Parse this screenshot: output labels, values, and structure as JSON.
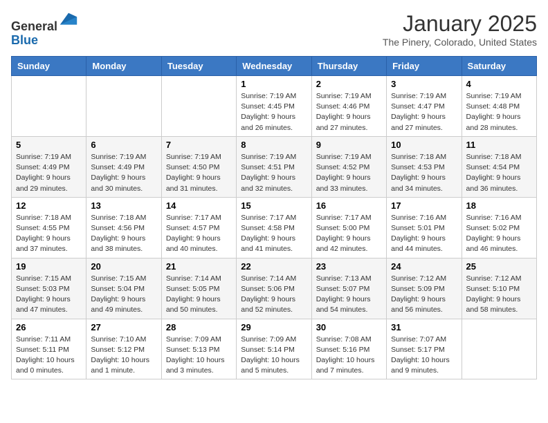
{
  "header": {
    "logo_line1": "General",
    "logo_line2": "Blue",
    "month": "January 2025",
    "location": "The Pinery, Colorado, United States"
  },
  "weekdays": [
    "Sunday",
    "Monday",
    "Tuesday",
    "Wednesday",
    "Thursday",
    "Friday",
    "Saturday"
  ],
  "weeks": [
    [
      {
        "day": "",
        "info": ""
      },
      {
        "day": "",
        "info": ""
      },
      {
        "day": "",
        "info": ""
      },
      {
        "day": "1",
        "info": "Sunrise: 7:19 AM\nSunset: 4:45 PM\nDaylight: 9 hours and 26 minutes."
      },
      {
        "day": "2",
        "info": "Sunrise: 7:19 AM\nSunset: 4:46 PM\nDaylight: 9 hours and 27 minutes."
      },
      {
        "day": "3",
        "info": "Sunrise: 7:19 AM\nSunset: 4:47 PM\nDaylight: 9 hours and 27 minutes."
      },
      {
        "day": "4",
        "info": "Sunrise: 7:19 AM\nSunset: 4:48 PM\nDaylight: 9 hours and 28 minutes."
      }
    ],
    [
      {
        "day": "5",
        "info": "Sunrise: 7:19 AM\nSunset: 4:49 PM\nDaylight: 9 hours and 29 minutes."
      },
      {
        "day": "6",
        "info": "Sunrise: 7:19 AM\nSunset: 4:49 PM\nDaylight: 9 hours and 30 minutes."
      },
      {
        "day": "7",
        "info": "Sunrise: 7:19 AM\nSunset: 4:50 PM\nDaylight: 9 hours and 31 minutes."
      },
      {
        "day": "8",
        "info": "Sunrise: 7:19 AM\nSunset: 4:51 PM\nDaylight: 9 hours and 32 minutes."
      },
      {
        "day": "9",
        "info": "Sunrise: 7:19 AM\nSunset: 4:52 PM\nDaylight: 9 hours and 33 minutes."
      },
      {
        "day": "10",
        "info": "Sunrise: 7:18 AM\nSunset: 4:53 PM\nDaylight: 9 hours and 34 minutes."
      },
      {
        "day": "11",
        "info": "Sunrise: 7:18 AM\nSunset: 4:54 PM\nDaylight: 9 hours and 36 minutes."
      }
    ],
    [
      {
        "day": "12",
        "info": "Sunrise: 7:18 AM\nSunset: 4:55 PM\nDaylight: 9 hours and 37 minutes."
      },
      {
        "day": "13",
        "info": "Sunrise: 7:18 AM\nSunset: 4:56 PM\nDaylight: 9 hours and 38 minutes."
      },
      {
        "day": "14",
        "info": "Sunrise: 7:17 AM\nSunset: 4:57 PM\nDaylight: 9 hours and 40 minutes."
      },
      {
        "day": "15",
        "info": "Sunrise: 7:17 AM\nSunset: 4:58 PM\nDaylight: 9 hours and 41 minutes."
      },
      {
        "day": "16",
        "info": "Sunrise: 7:17 AM\nSunset: 5:00 PM\nDaylight: 9 hours and 42 minutes."
      },
      {
        "day": "17",
        "info": "Sunrise: 7:16 AM\nSunset: 5:01 PM\nDaylight: 9 hours and 44 minutes."
      },
      {
        "day": "18",
        "info": "Sunrise: 7:16 AM\nSunset: 5:02 PM\nDaylight: 9 hours and 46 minutes."
      }
    ],
    [
      {
        "day": "19",
        "info": "Sunrise: 7:15 AM\nSunset: 5:03 PM\nDaylight: 9 hours and 47 minutes."
      },
      {
        "day": "20",
        "info": "Sunrise: 7:15 AM\nSunset: 5:04 PM\nDaylight: 9 hours and 49 minutes."
      },
      {
        "day": "21",
        "info": "Sunrise: 7:14 AM\nSunset: 5:05 PM\nDaylight: 9 hours and 50 minutes."
      },
      {
        "day": "22",
        "info": "Sunrise: 7:14 AM\nSunset: 5:06 PM\nDaylight: 9 hours and 52 minutes."
      },
      {
        "day": "23",
        "info": "Sunrise: 7:13 AM\nSunset: 5:07 PM\nDaylight: 9 hours and 54 minutes."
      },
      {
        "day": "24",
        "info": "Sunrise: 7:12 AM\nSunset: 5:09 PM\nDaylight: 9 hours and 56 minutes."
      },
      {
        "day": "25",
        "info": "Sunrise: 7:12 AM\nSunset: 5:10 PM\nDaylight: 9 hours and 58 minutes."
      }
    ],
    [
      {
        "day": "26",
        "info": "Sunrise: 7:11 AM\nSunset: 5:11 PM\nDaylight: 10 hours and 0 minutes."
      },
      {
        "day": "27",
        "info": "Sunrise: 7:10 AM\nSunset: 5:12 PM\nDaylight: 10 hours and 1 minute."
      },
      {
        "day": "28",
        "info": "Sunrise: 7:09 AM\nSunset: 5:13 PM\nDaylight: 10 hours and 3 minutes."
      },
      {
        "day": "29",
        "info": "Sunrise: 7:09 AM\nSunset: 5:14 PM\nDaylight: 10 hours and 5 minutes."
      },
      {
        "day": "30",
        "info": "Sunrise: 7:08 AM\nSunset: 5:16 PM\nDaylight: 10 hours and 7 minutes."
      },
      {
        "day": "31",
        "info": "Sunrise: 7:07 AM\nSunset: 5:17 PM\nDaylight: 10 hours and 9 minutes."
      },
      {
        "day": "",
        "info": ""
      }
    ]
  ]
}
